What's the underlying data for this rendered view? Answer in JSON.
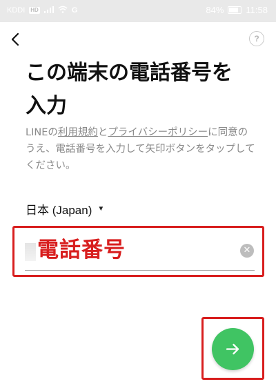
{
  "status_bar": {
    "carrier": "KDDI",
    "hd_badge": "HD",
    "network": "G",
    "battery": "84%",
    "time": "11:58"
  },
  "header": {
    "help_label": "?"
  },
  "title": {
    "line1": "この端末の電話番号を",
    "line2": "入力"
  },
  "terms": {
    "prefix": "LINEの",
    "terms_link": "利用規約",
    "and": "と",
    "privacy_link": "プライバシーポリシー",
    "suffix": "に同意のうえ、電話番号を入力して矢印ボタンをタップしてください。"
  },
  "country": {
    "selected": "日本 (Japan)"
  },
  "phone": {
    "value": "電話番号"
  },
  "colors": {
    "accent_green": "#40c463",
    "highlight_red": "#d81e1e"
  },
  "icons": {
    "back": "back-arrow-icon",
    "help": "help-icon",
    "clear": "clear-icon",
    "next": "arrow-right-icon"
  }
}
